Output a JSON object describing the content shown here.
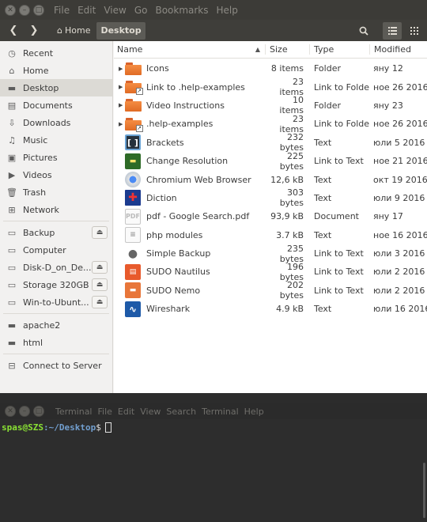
{
  "nautilus": {
    "menus": [
      "File",
      "Edit",
      "View",
      "Go",
      "Bookmarks",
      "Help"
    ],
    "breadcrumbs": [
      {
        "label": "Home",
        "icon": "home-icon"
      },
      {
        "label": "Desktop",
        "icon": ""
      }
    ],
    "sidebar": {
      "places": [
        {
          "label": "Recent",
          "icon": "clock-icon"
        },
        {
          "label": "Home",
          "icon": "home-icon"
        },
        {
          "label": "Desktop",
          "icon": "folder-icon",
          "selected": true
        },
        {
          "label": "Documents",
          "icon": "documents-icon"
        },
        {
          "label": "Downloads",
          "icon": "download-icon"
        },
        {
          "label": "Music",
          "icon": "music-icon"
        },
        {
          "label": "Pictures",
          "icon": "pictures-icon"
        },
        {
          "label": "Videos",
          "icon": "videos-icon"
        },
        {
          "label": "Trash",
          "icon": "trash-icon"
        },
        {
          "label": "Network",
          "icon": "network-icon"
        }
      ],
      "devices": [
        {
          "label": "Backup",
          "icon": "drive-icon",
          "eject": true
        },
        {
          "label": "Computer",
          "icon": "drive-icon",
          "eject": false
        },
        {
          "label": "Disk-D_on_De...",
          "icon": "drive-icon",
          "eject": true
        },
        {
          "label": "Storage 320GB",
          "icon": "drive-icon",
          "eject": true
        },
        {
          "label": "Win-to-Ubunt...",
          "icon": "drive-icon",
          "eject": true
        }
      ],
      "bookmarks": [
        {
          "label": "apache2",
          "icon": "folder-icon"
        },
        {
          "label": "html",
          "icon": "folder-icon"
        }
      ],
      "connect": {
        "label": "Connect to Server",
        "icon": "connect-server-icon"
      }
    },
    "columns": {
      "name": "Name",
      "size": "Size",
      "type": "Type",
      "modified": "Modified"
    },
    "files": [
      {
        "name": "Icons",
        "size": "8 items",
        "type": "Folder",
        "modified": "яну 12",
        "icon": "folder-icon",
        "expander": true,
        "link": false
      },
      {
        "name": "Link to .help-examples",
        "size": "23 items",
        "type": "Link to Folder",
        "modified": "ное 26 2016",
        "icon": "folder-icon",
        "expander": true,
        "link": true
      },
      {
        "name": "Video Instructions",
        "size": "10 items",
        "type": "Folder",
        "modified": "яну 23",
        "icon": "folder-icon",
        "expander": true,
        "link": false
      },
      {
        "name": ".help-examples",
        "size": "23 items",
        "type": "Link to Folder",
        "modified": "ное 26 2016",
        "icon": "folder-icon",
        "expander": true,
        "link": true
      },
      {
        "name": "Brackets",
        "size": "232 bytes",
        "type": "Text",
        "modified": "юли 5 2016",
        "icon": "brackets-icon"
      },
      {
        "name": "Change Resolution",
        "size": "225 bytes",
        "type": "Link to Text",
        "modified": "ное 21 2016",
        "icon": "monitor-icon"
      },
      {
        "name": "Chromium Web Browser",
        "size": "12,6 kB",
        "type": "Text",
        "modified": "окт 19 2016",
        "icon": "chromium-icon"
      },
      {
        "name": "Diction",
        "size": "303 bytes",
        "type": "Text",
        "modified": "юли 9 2016",
        "icon": "uk-flag-icon"
      },
      {
        "name": "pdf - Google Search.pdf",
        "size": "93,9 kB",
        "type": "Document",
        "modified": "яну 17",
        "icon": "pdf-document-icon"
      },
      {
        "name": "php modules",
        "size": "3.7 kB",
        "type": "Text",
        "modified": "ное 16 2016",
        "icon": "text-document-icon"
      },
      {
        "name": "Simple Backup",
        "size": "235 bytes",
        "type": "Link to Text",
        "modified": "юли 3 2016",
        "icon": "lightbulb-icon"
      },
      {
        "name": "SUDO Nautilus",
        "size": "196 bytes",
        "type": "Link to Text",
        "modified": "юли 2 2016",
        "icon": "files-red-icon"
      },
      {
        "name": "SUDO Nemo",
        "size": "202 bytes",
        "type": "Link to Text",
        "modified": "юли 2 2016",
        "icon": "folder-red-icon"
      },
      {
        "name": "Wireshark",
        "size": "4.9 kB",
        "type": "Text",
        "modified": "юли 16 2016",
        "icon": "wireshark-icon"
      }
    ]
  },
  "terminal": {
    "menus": [
      "Terminal",
      "File",
      "Edit",
      "View",
      "Search",
      "Terminal",
      "Help"
    ],
    "prompt_user": "spas@SZS",
    "prompt_path": ":~/Desktop",
    "prompt_symbol": "$"
  },
  "colors": {
    "menubar": "#3c3b37",
    "folder_orange": "#f58d43",
    "selection": "#dcdad5",
    "terminal_bg": "#2d2d2d",
    "prompt_green": "#8ae234",
    "prompt_blue": "#729fcf"
  }
}
